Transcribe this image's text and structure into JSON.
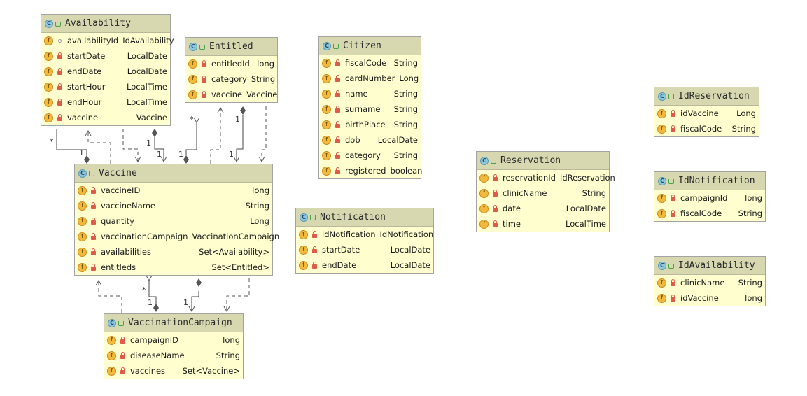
{
  "class_icon": "C",
  "field_icon": "f",
  "classes": {
    "availability": {
      "name": "Availability",
      "fields": [
        {
          "name": "availabilityId",
          "type": "IdAvailability"
        },
        {
          "name": "startDate",
          "type": "LocalDate"
        },
        {
          "name": "endDate",
          "type": "LocalDate"
        },
        {
          "name": "startHour",
          "type": "LocalTime"
        },
        {
          "name": "endHour",
          "type": "LocalTime"
        },
        {
          "name": "vaccine",
          "type": "Vaccine"
        }
      ]
    },
    "entitled": {
      "name": "Entitled",
      "fields": [
        {
          "name": "entitledId",
          "type": "long"
        },
        {
          "name": "category",
          "type": "String"
        },
        {
          "name": "vaccine",
          "type": "Vaccine"
        }
      ]
    },
    "citizen": {
      "name": "Citizen",
      "fields": [
        {
          "name": "fiscalCode",
          "type": "String"
        },
        {
          "name": "cardNumber",
          "type": "Long"
        },
        {
          "name": "name",
          "type": "String"
        },
        {
          "name": "surname",
          "type": "String"
        },
        {
          "name": "birthPlace",
          "type": "String"
        },
        {
          "name": "dob",
          "type": "LocalDate"
        },
        {
          "name": "category",
          "type": "String"
        },
        {
          "name": "registered",
          "type": "boolean"
        }
      ]
    },
    "vaccine": {
      "name": "Vaccine",
      "fields": [
        {
          "name": "vaccineID",
          "type": "long"
        },
        {
          "name": "vaccineName",
          "type": "String"
        },
        {
          "name": "quantity",
          "type": "Long"
        },
        {
          "name": "vaccinationCampaign",
          "type": "VaccinationCampaign"
        },
        {
          "name": "availabilities",
          "type": "Set<Availability>"
        },
        {
          "name": "entitleds",
          "type": "Set<Entitled>"
        }
      ]
    },
    "notification": {
      "name": "Notification",
      "fields": [
        {
          "name": "idNotification",
          "type": "IdNotification"
        },
        {
          "name": "startDate",
          "type": "LocalDate"
        },
        {
          "name": "endDate",
          "type": "LocalDate"
        }
      ]
    },
    "reservation": {
      "name": "Reservation",
      "fields": [
        {
          "name": "reservationId",
          "type": "IdReservation"
        },
        {
          "name": "clinicName",
          "type": "String"
        },
        {
          "name": "date",
          "type": "LocalDate"
        },
        {
          "name": "time",
          "type": "LocalTime"
        }
      ]
    },
    "idreservation": {
      "name": "IdReservation",
      "fields": [
        {
          "name": "idVaccine",
          "type": "Long"
        },
        {
          "name": "fiscalCode",
          "type": "String"
        }
      ]
    },
    "idnotification": {
      "name": "IdNotification",
      "fields": [
        {
          "name": "campaignId",
          "type": "long"
        },
        {
          "name": "fiscalCode",
          "type": "String"
        }
      ]
    },
    "idavailability": {
      "name": "IdAvailability",
      "fields": [
        {
          "name": "clinicName",
          "type": "String"
        },
        {
          "name": "idVaccine",
          "type": "long"
        }
      ]
    },
    "vaccinationcampaign": {
      "name": "VaccinationCampaign",
      "fields": [
        {
          "name": "campaignID",
          "type": "long"
        },
        {
          "name": "diseaseName",
          "type": "String"
        },
        {
          "name": "vaccines",
          "type": "Set<Vaccine>"
        }
      ]
    }
  },
  "multiplicities": {
    "availability_many": "*",
    "availability_one": "1",
    "availability_vaccine_one": "1",
    "availability_vaccine_one_b": "1",
    "entitled_many": "*",
    "entitled_one_a": "1",
    "entitled_one_b": "1",
    "entitled_one_c": "1",
    "campaign_many": "*",
    "campaign_one_a": "1",
    "campaign_one_b": "1"
  }
}
